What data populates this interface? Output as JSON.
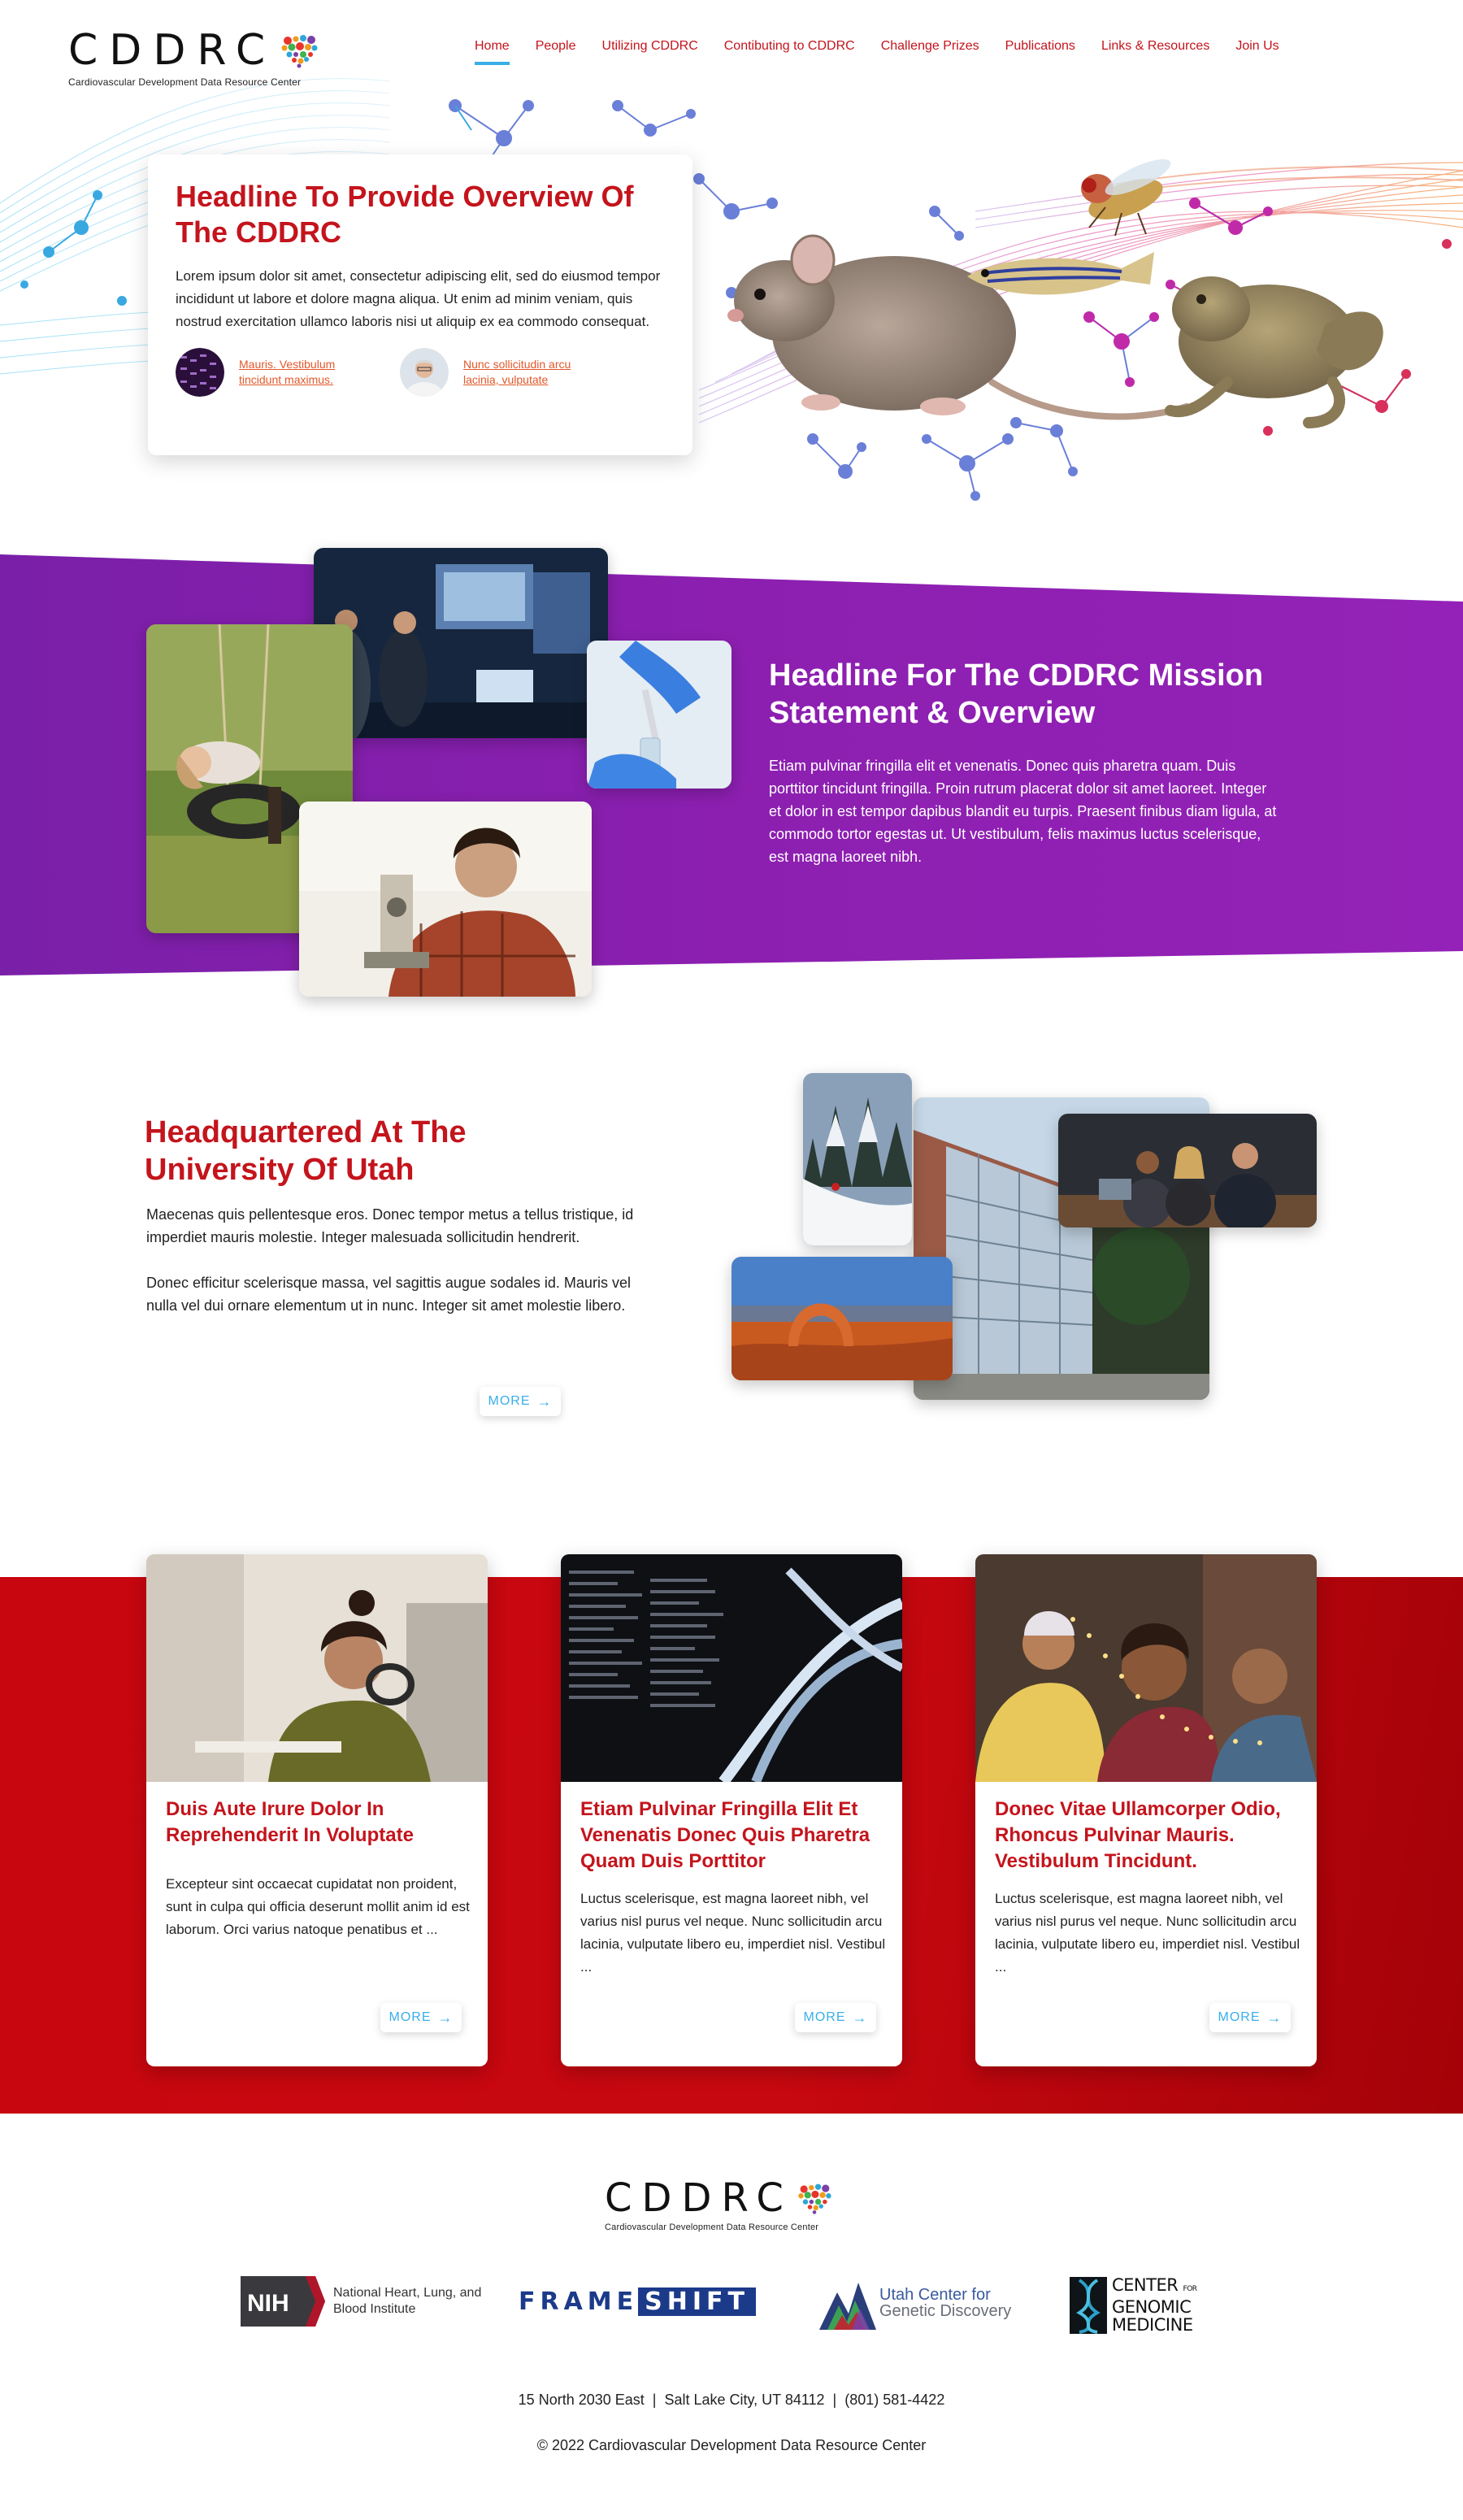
{
  "brand": {
    "wordmark": "CDDRC",
    "subtitle": "Cardiovascular Development Data Resource Center",
    "heart_colors": [
      "#e8352b",
      "#f29a1b",
      "#2ea6d8",
      "#7b3fa8",
      "#3fb34f"
    ]
  },
  "nav": {
    "items": [
      {
        "label": "Home",
        "active": true
      },
      {
        "label": "People"
      },
      {
        "label": "Utilizing CDDRC"
      },
      {
        "label": "Contibuting to CDDRC"
      },
      {
        "label": "Challenge Prizes"
      },
      {
        "label": "Publications"
      },
      {
        "label": "Links & Resources"
      },
      {
        "label": "Join Us"
      }
    ]
  },
  "hero": {
    "title": "Headline To Provide Overview Of The CDDRC",
    "body": "Lorem ipsum dolor sit amet, consectetur adipiscing elit, sed do eiusmod tempor incididunt ut labore et dolore magna aliqua. Ut enim ad minim veniam, quis nostrud exercitation ullamco laboris nisi ut aliquip ex ea commodo consequat.",
    "links": [
      {
        "text": "Mauris. Vestibulum tincidunt maximus.",
        "thumb": "dna-gel-thumbnail"
      },
      {
        "text": "Nunc sollicitudin arcu lacinia, vulputate",
        "thumb": "scientist-portrait-thumbnail"
      }
    ],
    "images": [
      "mouse",
      "zebrafish",
      "fruit-fly",
      "frog",
      "molecule-network"
    ]
  },
  "mission": {
    "title": "Headline For The CDDRC Mission Statement & Overview",
    "body": "Etiam pulvinar fringilla elit et venenatis. Donec quis pharetra quam. Duis porttitor tincidunt fringilla. Proin rutrum placerat dolor sit amet laoreet. Integer et dolor in est tempor dapibus blandit eu turpis. Praesent finibus diam ligula, at commodo tortor egestas ut. Ut vestibulum, felis maximus luctus scelerisque, est magna laoreet nibh.",
    "photos": [
      "lab-presentation",
      "girl-on-tire-swing",
      "pipette-vial",
      "student-microscope"
    ],
    "band_color": "#8c1fb0"
  },
  "hq": {
    "title": "Headquartered At The University Of Utah",
    "paragraphs": [
      "Maecenas quis pellentesque eros. Donec tempor metus a tellus tristique, id imperdiet mauris molestie. Integer malesuada sollicitudin hendrerit.",
      "Donec efficitur scelerisque massa, vel sagittis augue sodales id. Mauris vel nulla vel dui ornare elementum ut in nunc. Integer sit amet molestie libero."
    ],
    "more_label": "MORE",
    "photos": [
      "skier-snowy-trees",
      "university-building",
      "team-meeting",
      "delicate-arch"
    ]
  },
  "cards": [
    {
      "title": "Duis Aute Irure Dolor In Reprehenderit In Voluptate",
      "body": "Excepteur sint occaecat cupidatat non proident, sunt in culpa qui officia deserunt mollit anim id est laborum. Orci varius natoque penatibus et ...",
      "more_label": "MORE",
      "image": "student-writing"
    },
    {
      "title": "Etiam Pulvinar Fringilla Elit Et Venenatis Donec Quis Pharetra Quam Duis Porttitor",
      "body": "Luctus scelerisque, est magna laoreet nibh, vel varius nisl purus vel neque. Nunc sollicitudin arcu lacinia, vulputate libero eu, imperdiet nisl. Vestibul ...",
      "more_label": "MORE",
      "image": "dna-data-visualization"
    },
    {
      "title": "Donec Vitae Ullamcorper Odio, Rhoncus Pulvinar Mauris. Vestibulum Tincidunt.",
      "body": "Luctus scelerisque, est magna laoreet nibh, vel varius nisl purus vel neque. Nunc sollicitudin arcu lacinia, vulputate libero eu, imperdiet nisl. Vestibul ...",
      "more_label": "MORE",
      "image": "family-with-lights"
    }
  ],
  "footer": {
    "partners": {
      "nih": {
        "mark": "NIH",
        "name": "National Heart, Lung, and Blood Institute"
      },
      "frameshift": {
        "left": "FRAME",
        "right": "SHIFT"
      },
      "utah": {
        "line1": "Utah Center for",
        "line2": "Genetic Discovery"
      },
      "cgm": {
        "line1": "CENTER",
        "small": "FOR",
        "line2": "GENOMIC",
        "line3": "MEDICINE"
      }
    },
    "address_parts": [
      "15 North 2030 East",
      "Salt Lake City, UT 84112",
      "(801) 581-4422"
    ],
    "address": "15 North 2030 East  |  Salt Lake City, UT 84112  |  (801) 581-4422",
    "copyright": "© 2022 Cardiovascular Development Data Resource Center"
  },
  "colors": {
    "accent_red": "#c4141c",
    "link_blue": "#3aaee8",
    "link_orange": "#e2582a",
    "purple": "#8c1fb0"
  }
}
